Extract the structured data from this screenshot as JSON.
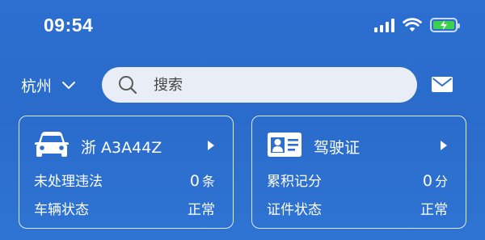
{
  "status_bar": {
    "time": "09:54",
    "battery_color": "#3fd14e"
  },
  "header": {
    "city": "杭州",
    "search": {
      "placeholder": "搜索"
    },
    "icons": {
      "dropdown": "chevron-down-icon",
      "search": "search-icon",
      "message": "mail-icon"
    }
  },
  "vehicle_card": {
    "icon": "car-icon",
    "title": "浙 A3A44Z",
    "violations_label": "未处理违法",
    "violations_count": "0",
    "violations_unit": "条",
    "status_label": "车辆状态",
    "status_value": "正常"
  },
  "license_card": {
    "icon": "id-card-icon",
    "title": "驾驶证",
    "points_label": "累积记分",
    "points_count": "0",
    "points_unit": "分",
    "status_label": "证件状态",
    "status_value": "正常"
  }
}
